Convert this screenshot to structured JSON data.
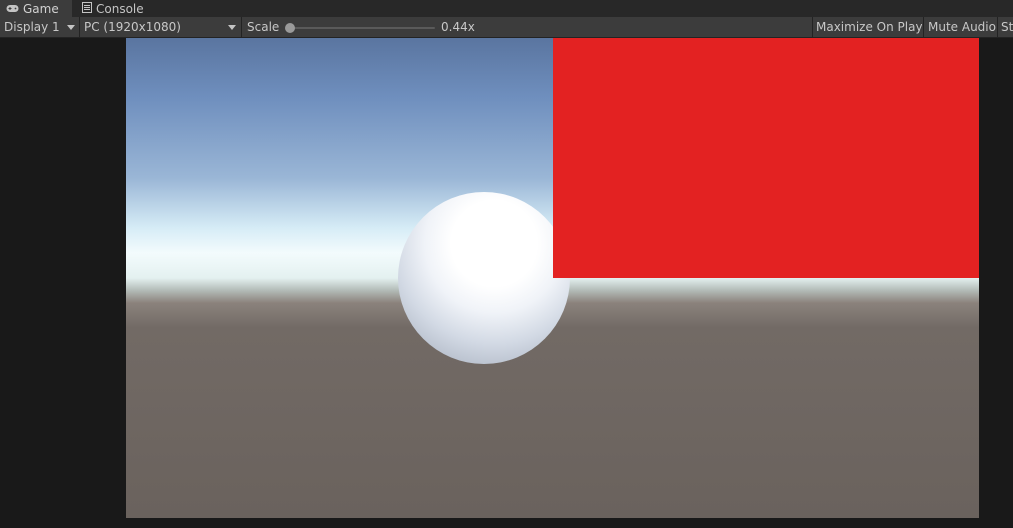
{
  "tabs": [
    {
      "label": "Game",
      "icon": "gamepad-icon",
      "active": true
    },
    {
      "label": "Console",
      "icon": "console-icon",
      "active": false
    }
  ],
  "toolbar": {
    "display": "Display 1",
    "resolution": "PC (1920x1080)",
    "scale_label": "Scale",
    "scale_value": "0.44x",
    "scale_fraction": 0.0,
    "maximize_label": "Maximize On Play",
    "mute_label": "Mute Audio",
    "stats_label": "St"
  },
  "colors": {
    "red_panel": "#e32222",
    "sky_top": "#5a75a0",
    "ground": "#6a625d"
  }
}
